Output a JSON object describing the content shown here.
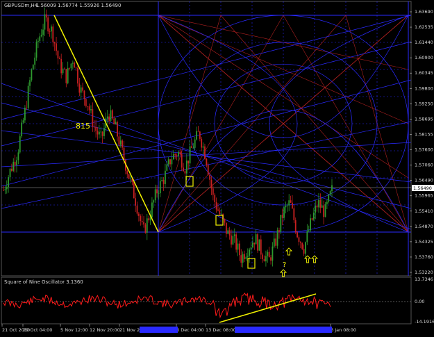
{
  "window": {
    "symbol_header": "GBPUSDm,H4",
    "ohlc": "1.56009 1.56774 1.55926 1.56490"
  },
  "colors": {
    "background": "#000000",
    "bull": "#2e9a2e",
    "bear": "#c82020",
    "grid_blue": "#2a2aff",
    "gann_red": "#b02020",
    "trend_yellow": "#f0f000",
    "osc_red": "#ff1a1a",
    "price_box": "#ffffff"
  },
  "annotations": {
    "move_label": "815",
    "question_mark": "?"
  },
  "oscillator": {
    "title": "Square of Nine Oscillator 3.1360",
    "scale_top": "13.7346",
    "scale_zero": "0.00",
    "scale_bottom": "-14.1916"
  },
  "price_box": {
    "value": "1.56490"
  },
  "chart_data": {
    "type": "line",
    "series": [
      {
        "values": [
          1.565,
          1.573,
          1.58,
          1.595,
          1.612,
          1.625,
          1.633,
          1.628,
          1.615,
          1.61,
          1.618,
          1.605,
          1.6,
          1.59,
          1.585,
          1.596,
          1.59,
          1.58,
          1.57,
          1.56,
          1.548,
          1.556,
          1.565,
          1.57,
          1.578,
          1.58,
          1.574,
          1.582,
          1.588,
          1.578,
          1.562,
          1.555,
          1.548,
          1.545,
          1.538,
          1.542,
          1.546,
          1.54,
          1.537,
          1.545,
          1.556,
          1.56,
          1.548,
          1.542,
          1.552,
          1.56,
          1.556,
          1.5649
        ]
      }
    ],
    "x_ticks": [
      "21 Oct 2010",
      "29 Oct 04:00",
      "5 Nov 12:00",
      "12 Nov 20:00",
      "21 Nov 20:00",
      "6 Dec 04:00",
      "13 Dec 08:00",
      "6 Jan 08:00"
    ],
    "y_ticks": [
      "1.63690",
      "1.62535",
      "1.61440",
      "1.60900",
      "1.60345",
      "1.59800",
      "1.59250",
      "1.58695",
      "1.58155",
      "1.57600",
      "1.57060",
      "1.56490",
      "1.55965",
      "1.55410",
      "1.54870",
      "1.54325",
      "1.53760",
      "1.53220"
    ],
    "ylim": [
      1.5322,
      1.638
    ]
  }
}
